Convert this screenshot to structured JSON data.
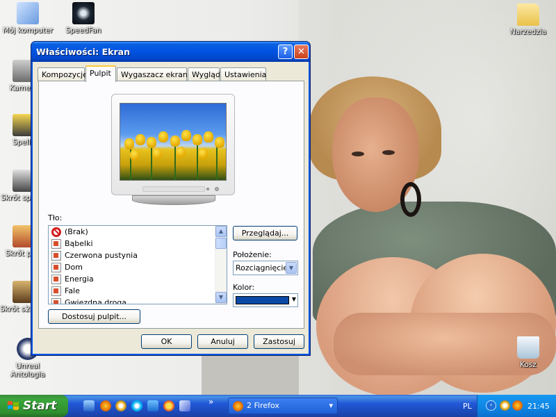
{
  "desktop": {
    "icons_left": [
      {
        "label": "Mój komputer"
      },
      {
        "label": "SpeedFan"
      },
      {
        "label": "Kamera"
      },
      {
        "label": "SpellF"
      },
      {
        "label": "Skrót spellfo"
      },
      {
        "label": "Skrót pdtr"
      },
      {
        "label": "Skrót s2dng_"
      },
      {
        "label": "Unreal Antologia"
      }
    ],
    "icons_right": [
      {
        "label": "Narzedzia"
      },
      {
        "label": "Kosz"
      }
    ]
  },
  "dialog": {
    "title": "Właściwości: Ekran",
    "help_label": "?",
    "close_label": "✕",
    "tabs": [
      {
        "label": "Kompozycje",
        "active": false
      },
      {
        "label": "Pulpit",
        "active": true
      },
      {
        "label": "Wygaszacz ekranu",
        "active": false
      },
      {
        "label": "Wygląd",
        "active": false
      },
      {
        "label": "Ustawienia",
        "active": false
      }
    ],
    "background_label": "Tło:",
    "background_items": [
      {
        "label": "(Brak)",
        "icon": "none-icon"
      },
      {
        "label": "Bąbelki",
        "icon": "image-file-icon"
      },
      {
        "label": "Czerwona pustynia",
        "icon": "image-file-icon"
      },
      {
        "label": "Dom",
        "icon": "image-file-icon"
      },
      {
        "label": "Energia",
        "icon": "image-file-icon"
      },
      {
        "label": "Fale",
        "icon": "image-file-icon"
      },
      {
        "label": "Gwiezdna droga",
        "icon": "image-file-icon"
      }
    ],
    "browse_label": "Przeglądaj...",
    "position_label": "Położenie:",
    "position_value": "Rozciągnięcie",
    "color_label": "Kolor:",
    "color_value": "#0a4aa6",
    "customize_label": "Dostosuj pulpit...",
    "ok_label": "OK",
    "cancel_label": "Anuluj",
    "apply_label": "Zastosuj"
  },
  "taskbar": {
    "start_label": "Start",
    "quick_launch_more": "»",
    "task_label": "2 Firefox",
    "task_arrow": "▾",
    "language": "PL",
    "language_hidden": "E",
    "clock": "21:45"
  },
  "colors": {
    "title_bar": "#0053e1",
    "dialog_face": "#ece9d8",
    "taskbar": "#2157d7",
    "start_button": "#3ba63b",
    "tray": "#0f89e6"
  }
}
